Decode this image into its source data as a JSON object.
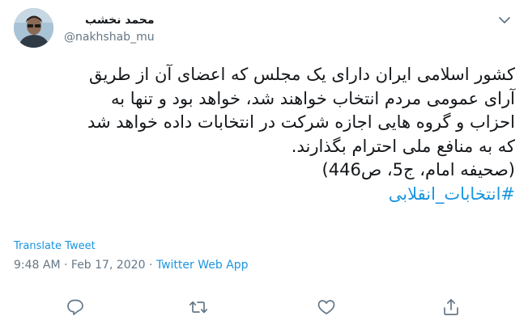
{
  "user": {
    "display_name": "محمد نخشب",
    "handle": "@nakhshab_mu",
    "avatar_icon": "user-avatar"
  },
  "tweet": {
    "lines": [
      "کشور اسلامی ایران دارای یک مجلس که اعضای آن از طریق",
      "آرای عمومی مردم انتخاب خواهند شد، خواهد بود و تنها به",
      "احزاب و گروه هایی اجازه شرکت در انتخابات داده خواهد شد",
      "که به منافع ملی احترام بگذارند.",
      "(صحیفه امام، ج5، ص446)"
    ],
    "hashtag": "#انتخابات_انقلابی"
  },
  "translate_label": "Translate Tweet",
  "meta": {
    "time": "9:48 AM",
    "separator1": " · ",
    "date": "Feb 17, 2020",
    "separator2": " · ",
    "source": "Twitter Web App"
  },
  "actions": {
    "reply_icon": "reply-icon",
    "retweet_icon": "retweet-icon",
    "like_icon": "heart-icon",
    "share_icon": "share-icon"
  },
  "colors": {
    "link": "#1b95e0",
    "secondary_text": "#657786",
    "primary_text": "#14171a",
    "icon": "#657786"
  }
}
